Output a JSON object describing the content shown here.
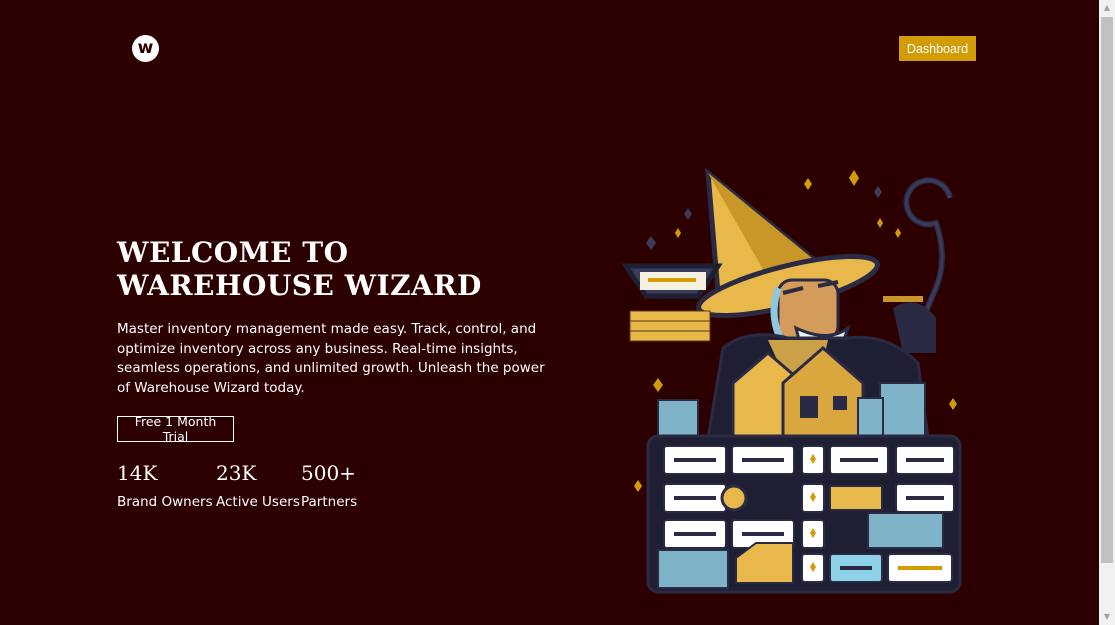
{
  "header": {
    "logo_letter": "w",
    "dashboard_label": "Dashboard"
  },
  "hero": {
    "title": "Welcome to Warehouse Wizard",
    "description": "Master inventory management made easy. Track, control, and optimize inventory across any business. Real-time insights, seamless operations, and unlimited growth. Unleash the power of Warehouse Wizard today.",
    "cta_label": "Free 1 Month Trial",
    "illustration": "wizard-warehouse-illustration"
  },
  "stats": [
    {
      "value": "14K",
      "label": "Brand Owners"
    },
    {
      "value": "23K",
      "label": "Active Users"
    },
    {
      "value": "500+",
      "label": "Partners"
    }
  ],
  "colors": {
    "background": "#2d0000",
    "accent": "#d19c06",
    "text": "#ffffff"
  }
}
